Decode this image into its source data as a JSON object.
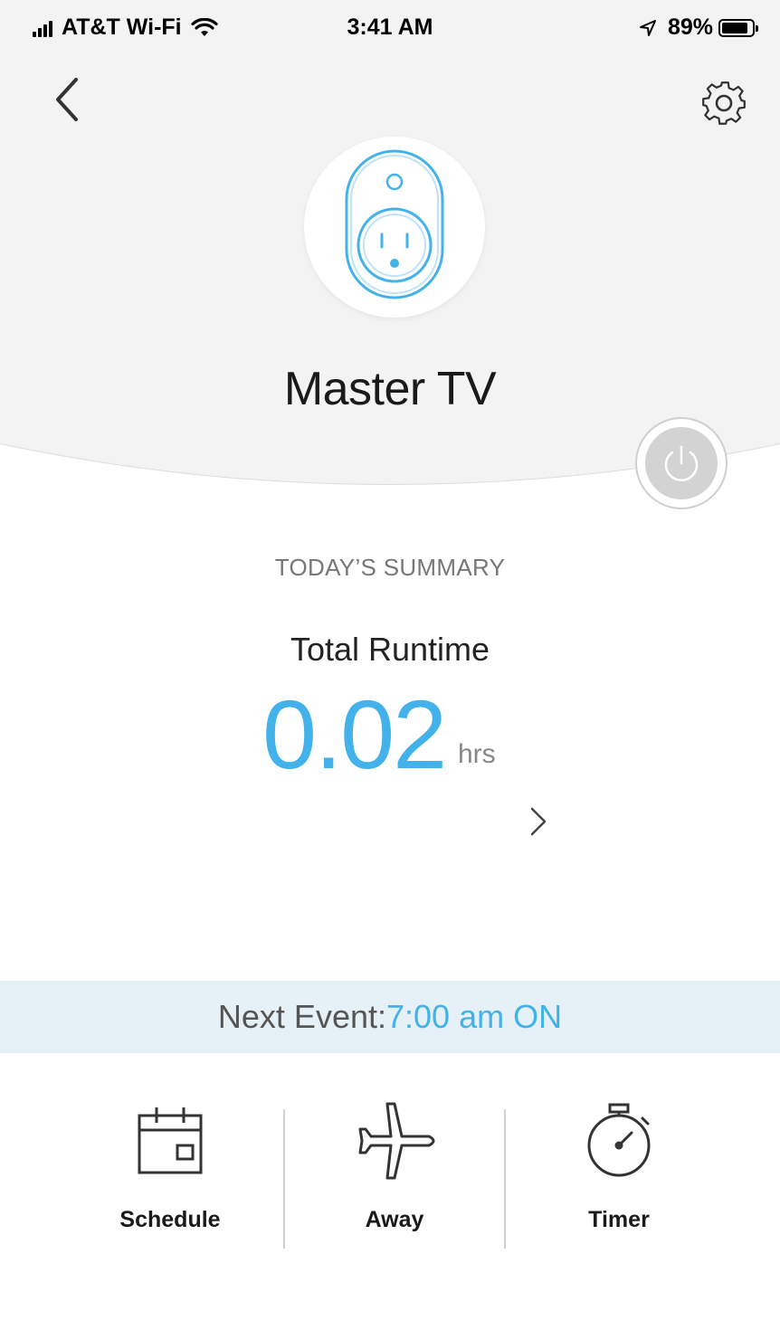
{
  "status_bar": {
    "carrier": "AT&T Wi-Fi",
    "time": "3:41 AM",
    "battery": "89%",
    "battery_level": 0.89
  },
  "header": {
    "back_icon": "chevron-left-icon",
    "settings_icon": "gear-icon",
    "device_icon": "smart-plug-icon",
    "device_name": "Master TV",
    "power_icon": "power-icon"
  },
  "summary": {
    "heading": "TODAY’S SUMMARY",
    "metric_label": "Total Runtime",
    "metric_value": "0.02",
    "metric_unit": "hrs",
    "detail_icon": "chevron-right-icon"
  },
  "next_event": {
    "label": "Next Event: ",
    "value": "7:00 am ON"
  },
  "actions": [
    {
      "label": "Schedule",
      "icon": "calendar-icon"
    },
    {
      "label": "Away",
      "icon": "airplane-icon"
    },
    {
      "label": "Timer",
      "icon": "stopwatch-icon"
    }
  ],
  "colors": {
    "accent": "#43b2ea",
    "header_bg": "#f3f3f3",
    "event_bar_bg": "#e6f1f7"
  }
}
